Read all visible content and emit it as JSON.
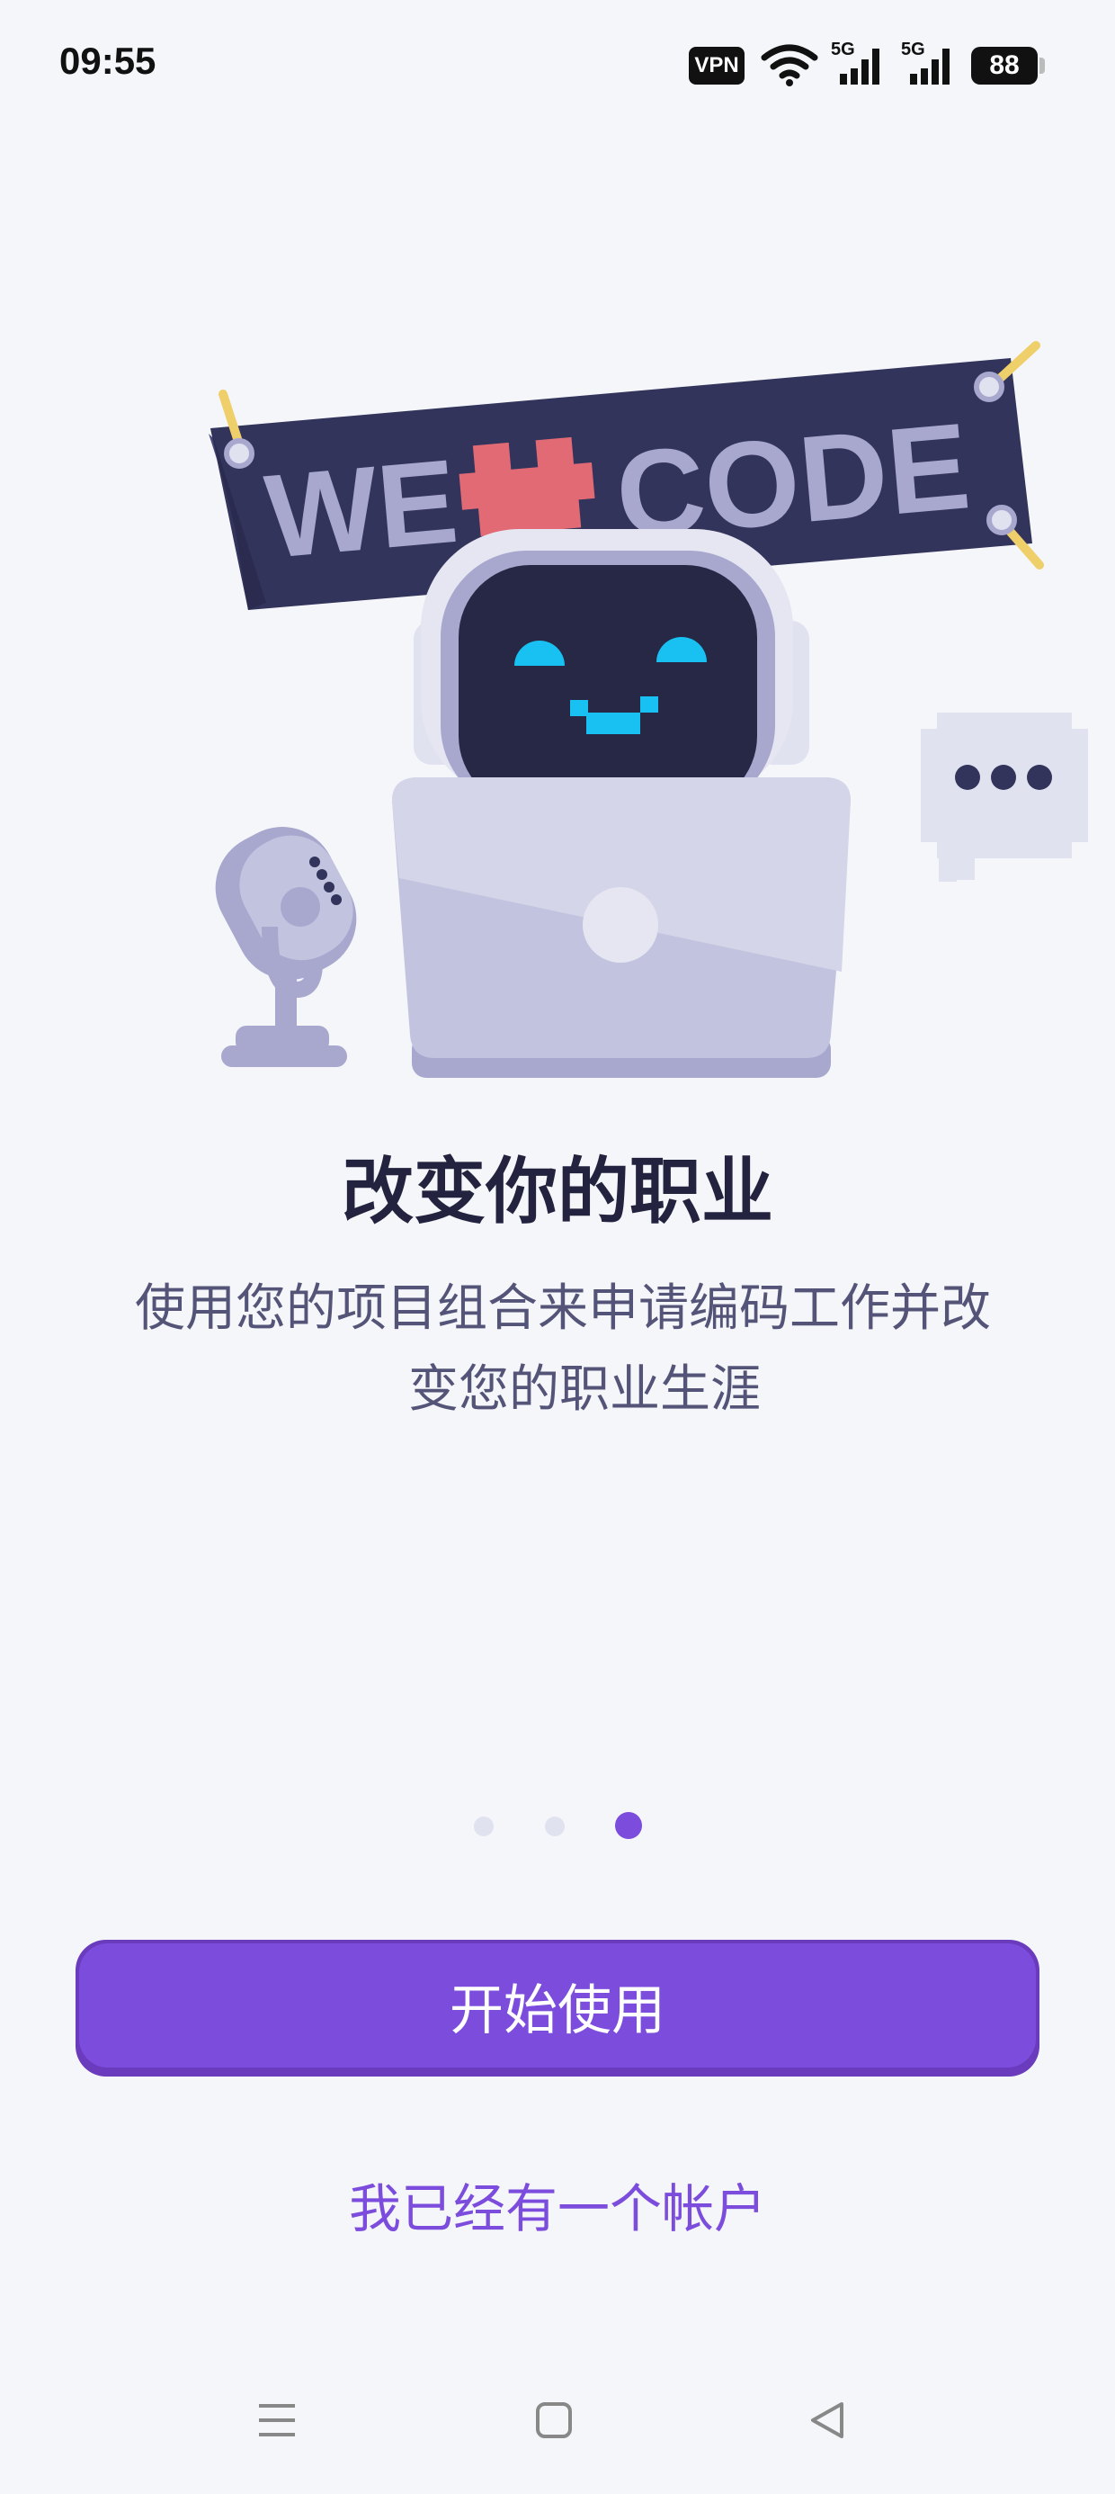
{
  "status_bar": {
    "time": "09:55",
    "vpn": "VPN",
    "signal_1_label": "5G",
    "signal_2_label": "5G",
    "battery": "88"
  },
  "illustration": {
    "banner_left": "WE",
    "banner_right": "CODE",
    "icon": "robot-laptop-illustration"
  },
  "onboarding": {
    "title": "改变你的职业",
    "subtitle_line1": "使用您的项目组合来申请编码工作并改",
    "subtitle_line2": "变您的职业生涯",
    "pages_total": 3,
    "active_page": 3
  },
  "actions": {
    "primary_label": "开始使用",
    "secondary_label": "我已经有一个帐户"
  },
  "colors": {
    "accent": "#7c4ddd",
    "accent_dark": "#6a3bbd",
    "background": "#f5f6fa",
    "title": "#23233f",
    "body": "#545478"
  },
  "nav_icons": [
    "menu-icon",
    "home-square-icon",
    "back-triangle-icon"
  ]
}
